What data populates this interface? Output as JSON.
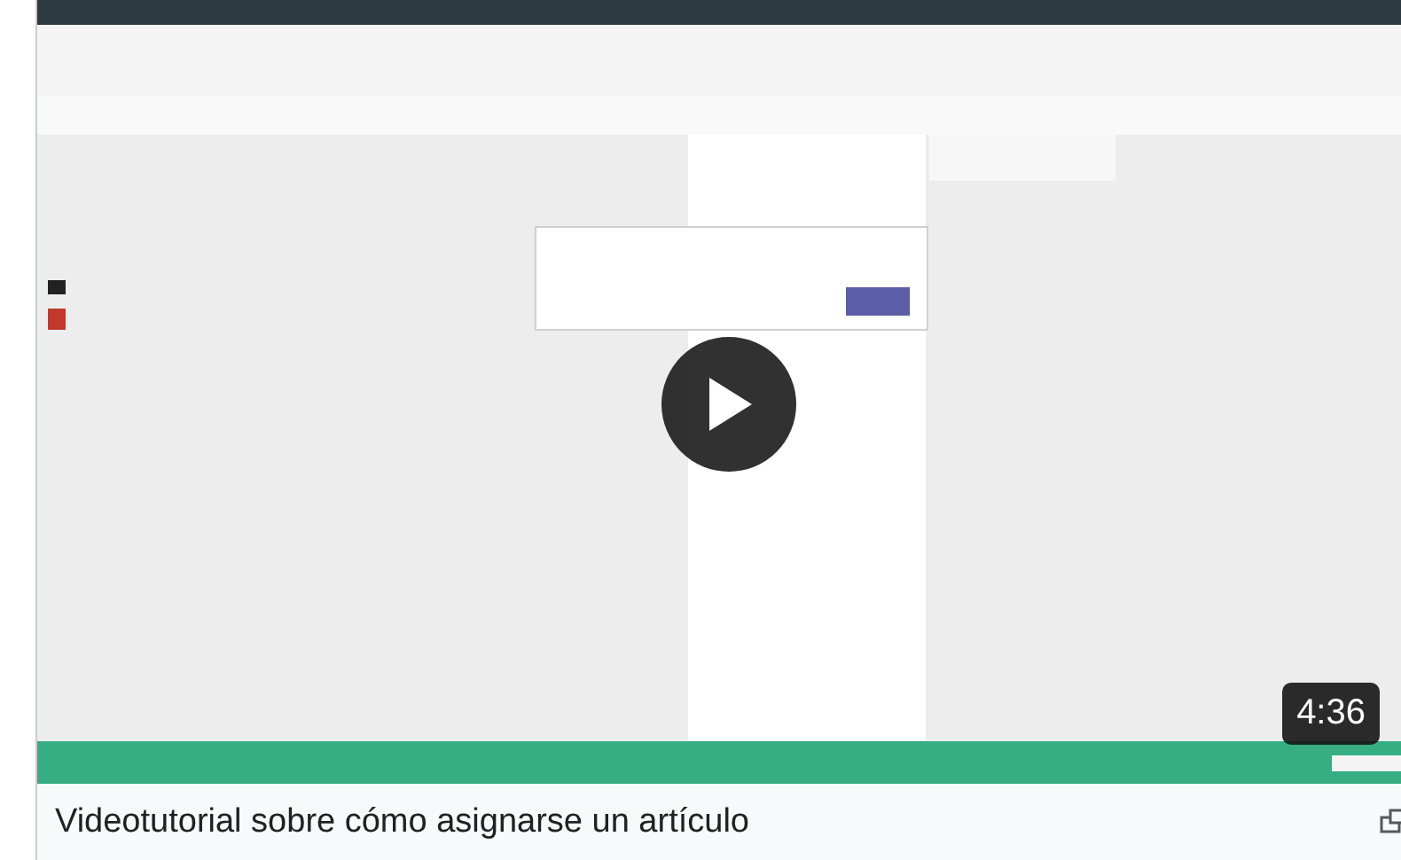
{
  "video": {
    "kind": "picture",
    "duration": "4:36"
  },
  "caption": {
    "title": "Videotutorial sobre cómo asignarse un artículo"
  }
}
